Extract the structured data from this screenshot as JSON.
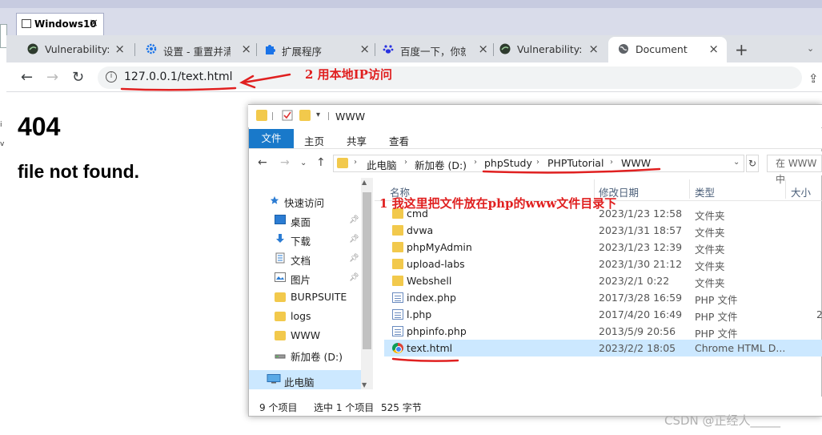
{
  "vm": {
    "tab_title": "Windows10",
    "close": "×"
  },
  "browser": {
    "tabs": [
      {
        "label": "Vulnerability: C",
        "icon": "dvwa-icon"
      },
      {
        "label": "设置 - 重置并清",
        "icon": "gear-icon"
      },
      {
        "label": "扩展程序",
        "icon": "puzzle-icon"
      },
      {
        "label": "百度一下，你就",
        "icon": "baidu-paw-icon"
      },
      {
        "label": "Vulnerability: C",
        "icon": "dvwa-icon"
      },
      {
        "label": "Document",
        "icon": "globe-icon",
        "active": true
      }
    ],
    "new_tab": "+",
    "url": "127.0.0.1/text.html"
  },
  "page": {
    "heading": "404",
    "message": "file not found."
  },
  "annotations": {
    "use_local_ip": "2 用本地IP访问",
    "placed_in_www": "1 我这里把文件放在php的www文件目录下"
  },
  "explorer": {
    "title": "WWW",
    "ribbon": {
      "file": "文件",
      "home": "主页",
      "share": "共享",
      "view": "查看"
    },
    "breadcrumb": [
      "此电脑",
      "新加卷 (D:)",
      "phpStudy",
      "PHPTutorial",
      "WWW"
    ],
    "search_placeholder": "在 WWW 中",
    "nav": [
      {
        "label": "快速访问",
        "icon": "star-icon"
      },
      {
        "label": "桌面",
        "icon": "desktop-icon",
        "pinned": true
      },
      {
        "label": "下载",
        "icon": "download-icon",
        "pinned": true
      },
      {
        "label": "文档",
        "icon": "document-icon",
        "pinned": true
      },
      {
        "label": "图片",
        "icon": "pictures-icon",
        "pinned": true
      },
      {
        "label": "BURPSUITE",
        "icon": "folder-icon"
      },
      {
        "label": "logs",
        "icon": "folder-icon"
      },
      {
        "label": "WWW",
        "icon": "folder-icon"
      },
      {
        "label": "新加卷 (D:)",
        "icon": "drive-icon"
      },
      {
        "label": "此电脑",
        "icon": "computer-icon",
        "selected": true
      }
    ],
    "columns": {
      "name": "名称",
      "modified": "修改日期",
      "type": "类型",
      "size": "大小"
    },
    "files": [
      {
        "name": "cmd",
        "modified": "2023/1/23 12:58",
        "type": "文件夹",
        "size": "",
        "kind": "folder"
      },
      {
        "name": "dvwa",
        "modified": "2023/1/31 18:57",
        "type": "文件夹",
        "size": "",
        "kind": "folder"
      },
      {
        "name": "phpMyAdmin",
        "modified": "2023/1/23 12:39",
        "type": "文件夹",
        "size": "",
        "kind": "folder"
      },
      {
        "name": "upload-labs",
        "modified": "2023/1/30 21:12",
        "type": "文件夹",
        "size": "",
        "kind": "folder"
      },
      {
        "name": "Webshell",
        "modified": "2023/2/1 0:22",
        "type": "文件夹",
        "size": "",
        "kind": "folder"
      },
      {
        "name": "index.php",
        "modified": "2017/3/28 16:59",
        "type": "PHP 文件",
        "size": "",
        "kind": "php"
      },
      {
        "name": "l.php",
        "modified": "2017/4/20 16:49",
        "type": "PHP 文件",
        "size": "2",
        "kind": "php"
      },
      {
        "name": "phpinfo.php",
        "modified": "2013/5/9 20:56",
        "type": "PHP 文件",
        "size": "",
        "kind": "php"
      },
      {
        "name": "text.html",
        "modified": "2023/2/2 18:05",
        "type": "Chrome HTML D...",
        "size": "",
        "kind": "chrome",
        "selected": true
      }
    ],
    "status": {
      "count": "9 个项目",
      "selected": "选中 1 个项目",
      "size": "525 字节"
    }
  },
  "watermark": "CSDN @正经人_____"
}
